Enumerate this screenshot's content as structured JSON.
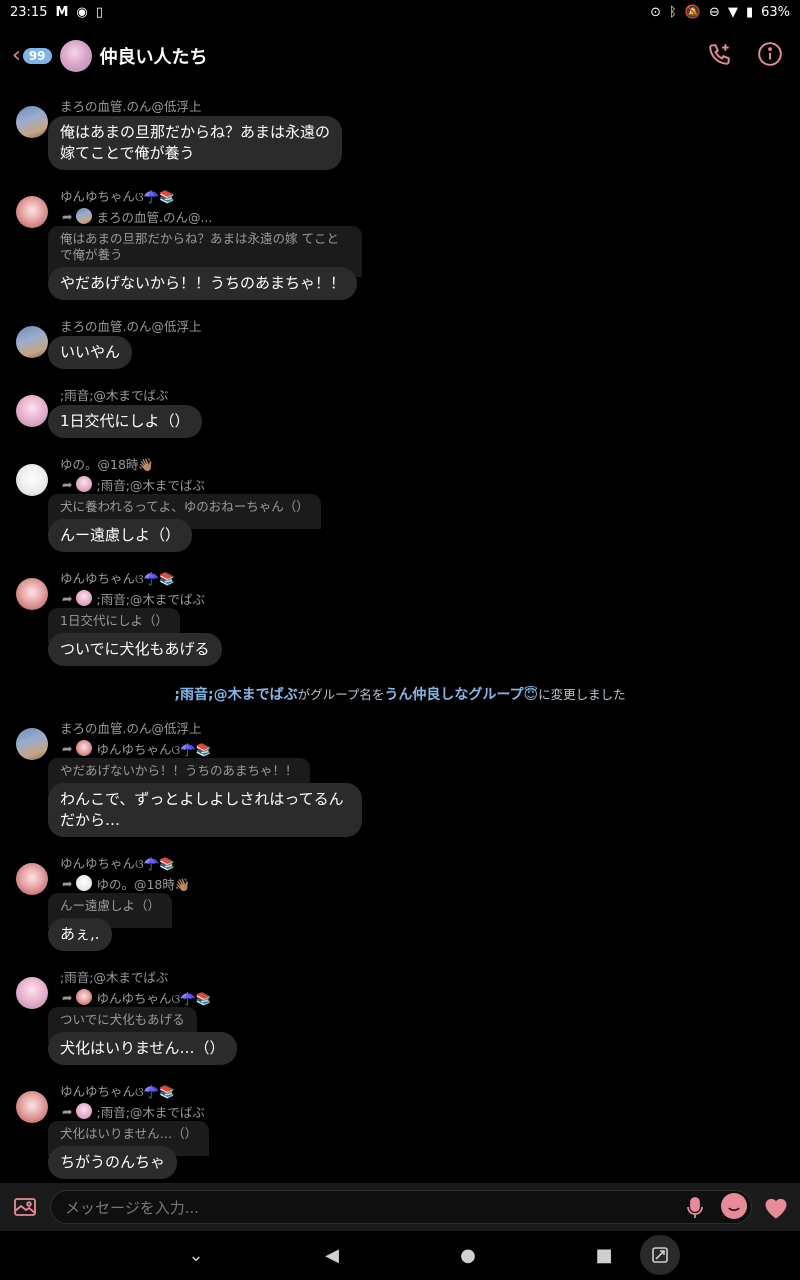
{
  "status": {
    "time": "23:15",
    "battery": "63%"
  },
  "header": {
    "unread_count": "99",
    "title": "仲良い人たち"
  },
  "colors": {
    "accent_pink": "#e88a9a",
    "accent_blue": "#7fb4e6"
  },
  "messages": [
    {
      "sender": "まろの血管.のん@低浮上",
      "text": "俺はあまの旦那だからね？あまは永遠の嫁てことで俺が養う"
    },
    {
      "sender": "ゆんゆちゃんଓ☂️📚",
      "forward_from": "まろの血管.のん@...",
      "quote": "俺はあまの旦那だからね？あまは永遠の嫁 てことで俺が養う",
      "text": "やだあげないから！！うちのあまちゃ！！"
    },
    {
      "sender": "まろの血管.のん@低浮上",
      "text": "いいやん"
    },
    {
      "sender": ";雨音;@木までばぶ",
      "text": "1日交代にしよ（）"
    },
    {
      "sender": "ゆの。@18時👋🏽",
      "forward_from": ";雨音;@木までばぶ",
      "quote": "犬に養われるってよ、ゆのおねーちゃん（）",
      "text": "んー遠慮しよ（）"
    },
    {
      "sender": "ゆんゆちゃんଓ☂️📚",
      "forward_from": ";雨音;@木までばぶ",
      "quote": "1日交代にしよ（）",
      "text": "ついでに犬化もあげる"
    },
    {
      "sender": "まろの血管.のん@低浮上",
      "forward_from": "ゆんゆちゃんଓ☂️📚",
      "quote": "やだあげないから！！うちのあまちゃ！！",
      "text": "わんこで、ずっとよしよしされはってるんだから…"
    },
    {
      "sender": "ゆんゆちゃんଓ☂️📚",
      "forward_from": "ゆの。@18時👋🏽",
      "quote": "んー遠慮しよ（）",
      "text": "あぇ,."
    },
    {
      "sender": ";雨音;@木までばぶ",
      "forward_from": "ゆんゆちゃんଓ☂️📚",
      "quote": "ついでに犬化もあげる",
      "text": "犬化はいりません…（）"
    },
    {
      "sender": "ゆんゆちゃんଓ☂️📚",
      "forward_from": ";雨音;@木までばぶ",
      "quote": "犬化はいりません…（）",
      "text": "ちがうのんちゃ"
    }
  ],
  "system": {
    "actor": ";雨音;@木までばぶ",
    "text1": "がグループ名を",
    "new_name": "うん仲良しなグループ😇",
    "text2": "に変更しました"
  },
  "composer": {
    "placeholder": "メッセージを入力..."
  }
}
